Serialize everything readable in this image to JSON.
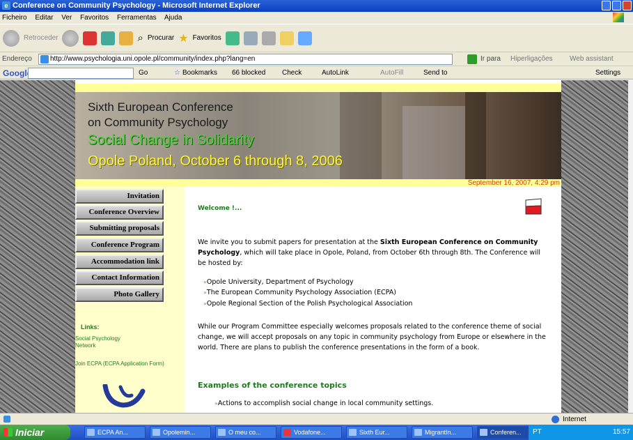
{
  "window": {
    "title": "Conference on Community Psychology - Microsoft Internet Explorer"
  },
  "menu": [
    "Ficheiro",
    "Editar",
    "Ver",
    "Favoritos",
    "Ferramentas",
    "Ajuda"
  ],
  "toolbar": {
    "back": "Retroceder",
    "search": "Procurar",
    "favorites": "Favoritos"
  },
  "address": {
    "label": "Endereço",
    "url": "http://www.psychologia.uni.opole.pl/community/index.php?lang=en",
    "go": "Ir para",
    "links": "Hiperligações",
    "web_assistant": "Web assistant"
  },
  "google": {
    "logo": "Google",
    "go": "Go",
    "bookmarks": "Bookmarks",
    "blocked": "66 blocked",
    "check": "Check",
    "autolink": "AutoLink",
    "autofill": "AutoFill",
    "sendto": "Send to",
    "settings": "Settings"
  },
  "banner": {
    "line1": "Sixth European Conference",
    "line2": "on Community Psychology",
    "line3": "Social Change in Solidarity",
    "line4": "Opole Poland, October 6 through 8, 2006"
  },
  "date": "September 16, 2007, 4:29 pm",
  "nav": [
    "Invitation",
    "Conference Overview",
    "Submitting proposals",
    "Conference Program",
    "Accommodation link",
    "Contact Information",
    "Photo Gallery"
  ],
  "links": {
    "title": "Links:",
    "items": [
      "Social Psychology Network",
      "Join ECPA (ECPA Application Form)"
    ]
  },
  "main": {
    "welcome": "Welcome !...",
    "intro_a": "We invite you to submit papers for presentation at the ",
    "intro_b": "Sixth European Conference on Community Psychology",
    "intro_c": ", which will take place in Opole, Poland, from October 6th through 8th. The Conference will be hosted by:",
    "hosts": [
      "Opole University, Department of Psychology",
      "The European Community Psychology Association (ECPA)",
      "Opole Regional Section of the Polish Psychological Association"
    ],
    "para2": "While our Program Committee especially welcomes proposals related to the conference theme of social change, we will accept proposals on any topic in community psychology from Europe or elsewhere in the world. There are plans to publish the conference presentations in the form of a book.",
    "examples_title": "Examples of the conference topics",
    "topic1": "Actions to accomplish social change in local community settings."
  },
  "status": {
    "zone": "Internet"
  },
  "taskbar": {
    "start": "Iniciar",
    "tasks": [
      "ECPA An...",
      "Opolemin...",
      "O meu co...",
      "Vodafone...",
      "Sixth Eur...",
      "MigrantIn...",
      "Conferen..."
    ],
    "lang": "PT",
    "time": "15:57"
  }
}
